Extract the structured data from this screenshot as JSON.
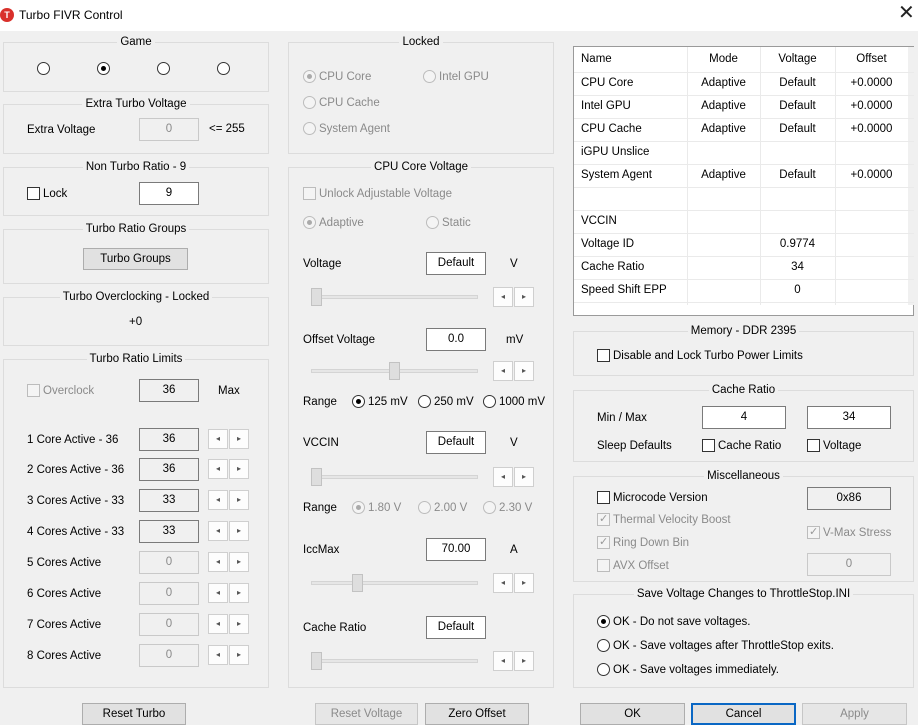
{
  "window": {
    "title": "Turbo FIVR Control",
    "icon_letter": "T"
  },
  "game": {
    "title": "Game"
  },
  "extra_turbo": {
    "title": "Extra Turbo Voltage",
    "label": "Extra Voltage",
    "value": "0",
    "limit": "<= 255"
  },
  "non_turbo": {
    "title": "Non Turbo Ratio - 9",
    "lock_label": "Lock",
    "value": "9"
  },
  "turbo_groups": {
    "title": "Turbo Ratio Groups",
    "button": "Turbo Groups"
  },
  "turbo_oc": {
    "title": "Turbo Overclocking - Locked",
    "value": "+0"
  },
  "turbo_limits": {
    "title": "Turbo Ratio Limits",
    "overclock_label": "Overclock",
    "overclock_value": "36",
    "max_label": "Max",
    "rows": [
      {
        "label": "1 Core  Active - 36",
        "value": "36"
      },
      {
        "label": "2 Cores Active - 36",
        "value": "36"
      },
      {
        "label": "3 Cores Active - 33",
        "value": "33"
      },
      {
        "label": "4 Cores Active - 33",
        "value": "33"
      },
      {
        "label": "5 Cores Active",
        "value": "0"
      },
      {
        "label": "6 Cores Active",
        "value": "0"
      },
      {
        "label": "7 Cores Active",
        "value": "0"
      },
      {
        "label": "8 Cores Active",
        "value": "0"
      }
    ]
  },
  "locked": {
    "title": "Locked",
    "cpu_core": "CPU Core",
    "intel_gpu": "Intel GPU",
    "cpu_cache": "CPU Cache",
    "system_agent": "System Agent"
  },
  "core_voltage": {
    "title": "CPU Core Voltage",
    "unlock_label": "Unlock Adjustable Voltage",
    "adaptive": "Adaptive",
    "static": "Static",
    "voltage_label": "Voltage",
    "voltage_value": "Default",
    "voltage_unit": "V",
    "offset_label": "Offset Voltage",
    "offset_value": "0.0",
    "offset_unit": "mV",
    "range_label": "Range",
    "range_opts": [
      "125 mV",
      "250 mV",
      "1000 mV"
    ],
    "vccin_label": "VCCIN",
    "vccin_value": "Default",
    "vccin_unit": "V",
    "vccin_range_label": "Range",
    "vccin_opts": [
      "1.80 V",
      "2.00 V",
      "2.30 V"
    ],
    "iccmax_label": "IccMax",
    "iccmax_value": "70.00",
    "iccmax_unit": "A",
    "cache_label": "Cache Ratio",
    "cache_value": "Default"
  },
  "table": {
    "headers": [
      "Name",
      "Mode",
      "Voltage",
      "Offset"
    ],
    "rows": [
      [
        "CPU Core",
        "Adaptive",
        "Default",
        "+0.0000"
      ],
      [
        "Intel GPU",
        "Adaptive",
        "Default",
        "+0.0000"
      ],
      [
        "CPU Cache",
        "Adaptive",
        "Default",
        "+0.0000"
      ],
      [
        "iGPU Unslice",
        "",
        "",
        ""
      ],
      [
        "System Agent",
        "Adaptive",
        "Default",
        "+0.0000"
      ],
      [
        "",
        "",
        "",
        ""
      ],
      [
        "VCCIN",
        "",
        "",
        ""
      ],
      [
        "Voltage ID",
        "",
        "0.9774",
        ""
      ],
      [
        "Cache Ratio",
        "",
        "34",
        ""
      ],
      [
        "Speed Shift EPP",
        "",
        "0",
        ""
      ]
    ]
  },
  "memory": {
    "title": "Memory - DDR 2395",
    "disable_label": "Disable and Lock Turbo Power Limits"
  },
  "cache_ratio": {
    "title": "Cache Ratio",
    "minmax_label": "Min / Max",
    "min_value": "4",
    "max_value": "34",
    "sleep_label": "Sleep Defaults",
    "sleep_cache": "Cache Ratio",
    "sleep_voltage": "Voltage"
  },
  "misc": {
    "title": "Miscellaneous",
    "microcode_label": "Microcode Version",
    "microcode_value": "0x86",
    "tvb_label": "Thermal Velocity Boost",
    "vmax_label": "V-Max Stress",
    "ringdown_label": "Ring Down Bin",
    "avx_label": "AVX Offset",
    "avx_value": "0"
  },
  "save": {
    "title": "Save Voltage Changes to ThrottleStop.INI",
    "opt1": "OK - Do not save voltages.",
    "opt2": "OK - Save voltages after ThrottleStop exits.",
    "opt3": "OK - Save voltages immediately."
  },
  "footer": {
    "reset_turbo": "Reset Turbo",
    "reset_voltage": "Reset Voltage",
    "zero_offset": "Zero Offset",
    "ok": "OK",
    "cancel": "Cancel",
    "apply": "Apply"
  }
}
